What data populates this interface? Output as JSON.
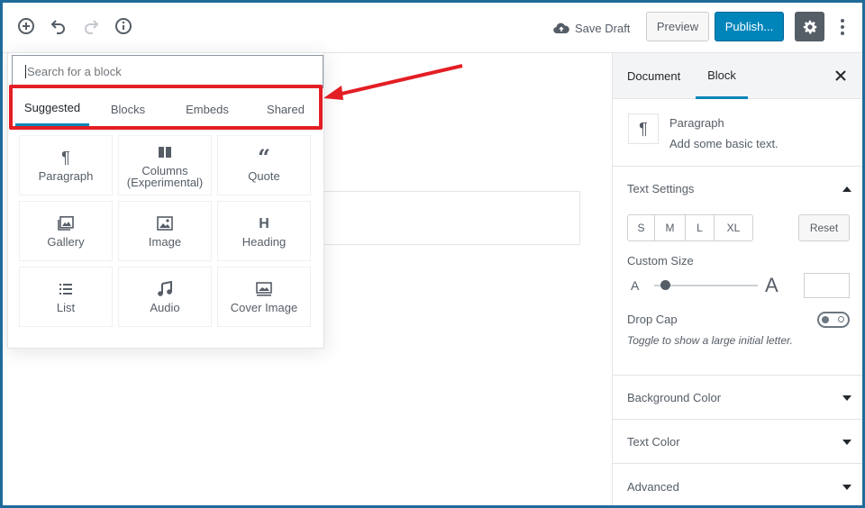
{
  "toolbar": {
    "save_draft_label": "Save Draft",
    "preview_label": "Preview",
    "publish_label": "Publish...",
    "icons": [
      "add-block-icon",
      "undo-icon",
      "redo-icon",
      "info-icon",
      "cloud-upload-icon",
      "gear-icon",
      "more-vertical-icon"
    ]
  },
  "inserter": {
    "search_placeholder": "Search for a block",
    "tabs": [
      {
        "label": "Suggested",
        "active": true
      },
      {
        "label": "Blocks",
        "active": false
      },
      {
        "label": "Embeds",
        "active": false
      },
      {
        "label": "Shared",
        "active": false
      }
    ],
    "blocks": [
      {
        "label": "Paragraph",
        "icon": "paragraph-icon"
      },
      {
        "label": "Columns (Experimental)",
        "icon": "columns-icon"
      },
      {
        "label": "Quote",
        "icon": "quote-icon"
      },
      {
        "label": "Gallery",
        "icon": "gallery-icon"
      },
      {
        "label": "Image",
        "icon": "image-icon"
      },
      {
        "label": "Heading",
        "icon": "heading-icon"
      },
      {
        "label": "List",
        "icon": "list-icon"
      },
      {
        "label": "Audio",
        "icon": "audio-icon"
      },
      {
        "label": "Cover Image",
        "icon": "cover-image-icon"
      }
    ]
  },
  "sidebar": {
    "tabs": [
      {
        "label": "Document",
        "active": false
      },
      {
        "label": "Block",
        "active": true
      }
    ],
    "block_card": {
      "title": "Paragraph",
      "description": "Add some basic text."
    },
    "text_settings": {
      "title": "Text Settings",
      "sizes": [
        "S",
        "M",
        "L",
        "XL"
      ],
      "reset_label": "Reset",
      "custom_size_label": "Custom Size",
      "small_a": "A",
      "large_a": "A",
      "custom_size_value": "",
      "drop_cap_label": "Drop Cap",
      "drop_cap_enabled": false,
      "drop_cap_help": "Toggle to show a large initial letter."
    },
    "panels": [
      {
        "title": "Background Color"
      },
      {
        "title": "Text Color"
      },
      {
        "title": "Advanced"
      }
    ]
  },
  "colors": {
    "accent": "#0085ba",
    "annotation_red": "#e31e24",
    "frame_border": "#1e6b9a"
  }
}
